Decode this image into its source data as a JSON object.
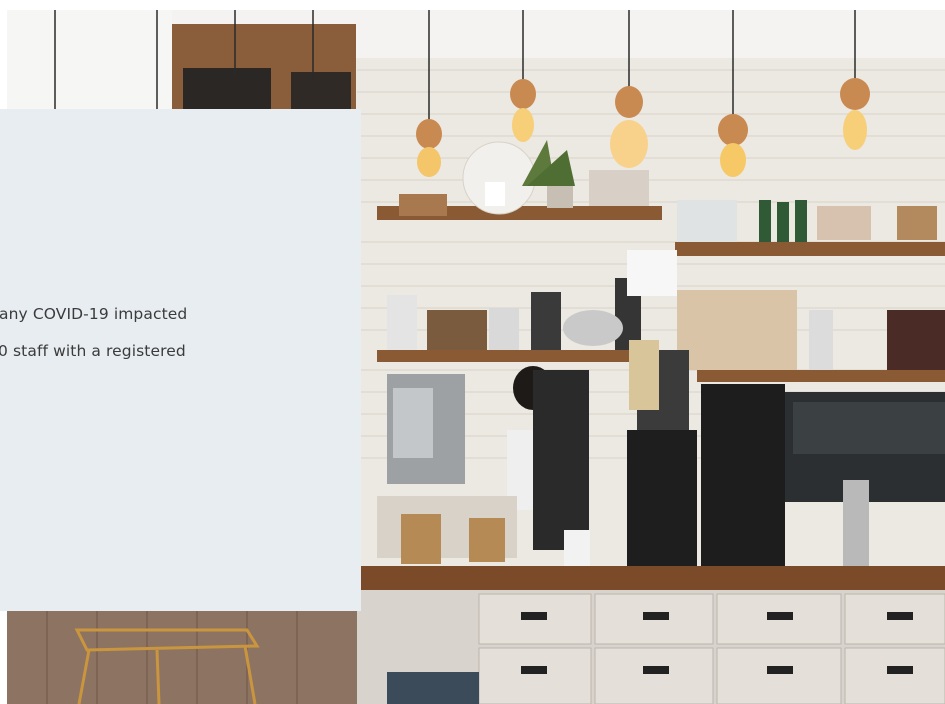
{
  "hero": {
    "photo_alt": "Coffee shop counter with pendant bulbs, shelves, grinders and an espresso machine",
    "text_lines": [
      "any COVID-19 impacted",
      "0 staff with a registered"
    ]
  },
  "colors": {
    "panel_bg": "#e8edf2",
    "text": "#3b3b3b",
    "wood": "#8a5a34",
    "brick": "#e9e4dc"
  }
}
